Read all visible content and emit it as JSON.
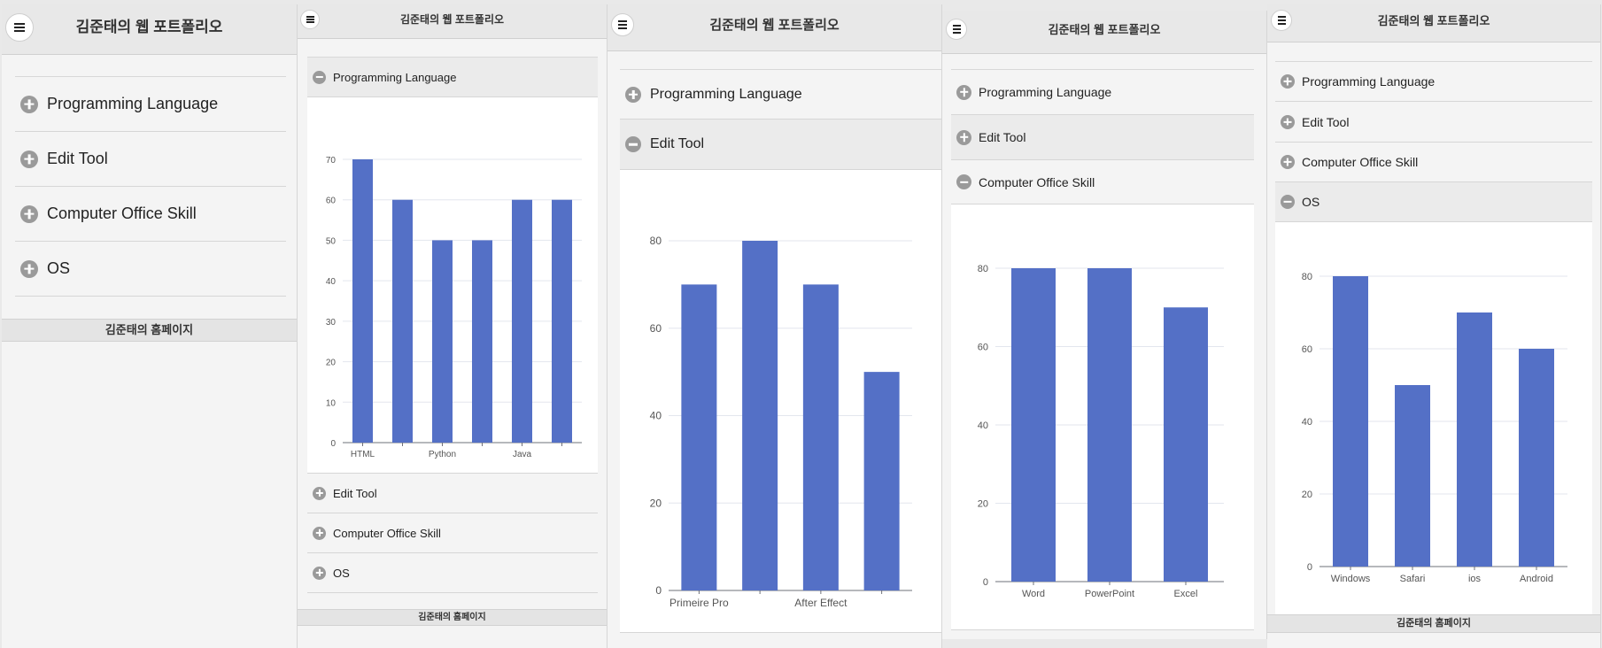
{
  "header": {
    "title": "김준태의 웹 포트폴리오"
  },
  "accordion": {
    "programming": "Programming Language",
    "edit": "Edit Tool",
    "office": "Computer Office Skill",
    "os": "OS"
  },
  "footer": {
    "text": "김준태의 홈페이지"
  },
  "chart_data": [
    {
      "type": "bar",
      "section": "Programming Language",
      "categories": [
        "HTML",
        "",
        "Python",
        "",
        "Java",
        ""
      ],
      "values": [
        70,
        60,
        50,
        50,
        60,
        60
      ],
      "yticks": [
        "0",
        "10",
        "20",
        "30",
        "40",
        "50",
        "60",
        "70"
      ],
      "ylim": [
        0,
        70
      ],
      "color": "#5470c6"
    },
    {
      "type": "bar",
      "section": "Edit Tool",
      "categories": [
        "Primeire Pro",
        "",
        "After Effect",
        ""
      ],
      "values": [
        70,
        80,
        70,
        50
      ],
      "yticks": [
        "0",
        "20",
        "40",
        "60",
        "80"
      ],
      "ylim": [
        0,
        80
      ],
      "color": "#5470c6"
    },
    {
      "type": "bar",
      "section": "Computer Office Skill",
      "categories": [
        "Word",
        "PowerPoint",
        "Excel"
      ],
      "values": [
        80,
        80,
        70
      ],
      "yticks": [
        "0",
        "20",
        "40",
        "60",
        "80"
      ],
      "ylim": [
        0,
        80
      ],
      "color": "#5470c6"
    },
    {
      "type": "bar",
      "section": "OS",
      "categories": [
        "Windows",
        "Safari",
        "ios",
        "Android"
      ],
      "values": [
        80,
        50,
        70,
        60
      ],
      "yticks": [
        "0",
        "20",
        "40",
        "60",
        "80"
      ],
      "ylim": [
        0,
        80
      ],
      "color": "#5470c6"
    }
  ]
}
